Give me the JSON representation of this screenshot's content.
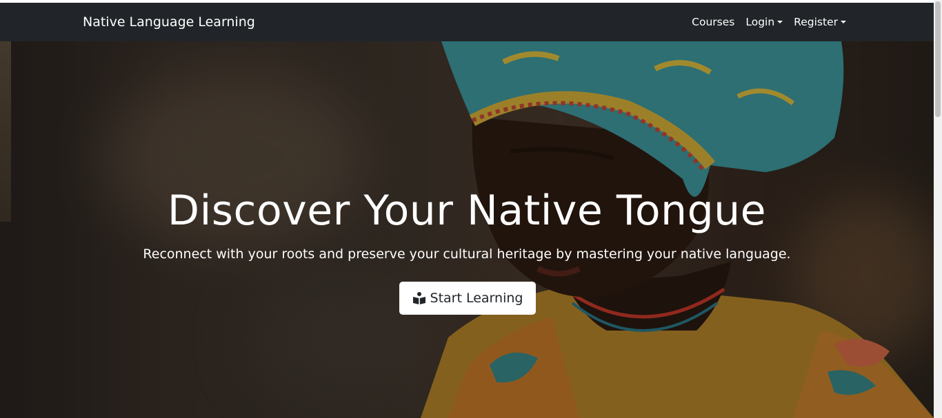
{
  "navbar": {
    "brand": "Native Language Learning",
    "links": [
      {
        "label": "Courses",
        "dropdown": false
      },
      {
        "label": "Login",
        "dropdown": true
      },
      {
        "label": "Register",
        "dropdown": true
      }
    ],
    "background": "#212529"
  },
  "hero": {
    "title": "Discover Your Native Tongue",
    "subtitle": "Reconnect with your roots and preserve your cultural heritage by mastering your native language.",
    "cta_label": "Start Learning",
    "cta_icon": "book-reader-icon"
  },
  "colors": {
    "navbar_bg": "#212529",
    "text_light": "#ffffff",
    "button_bg": "#ffffff",
    "button_text": "#212529"
  }
}
